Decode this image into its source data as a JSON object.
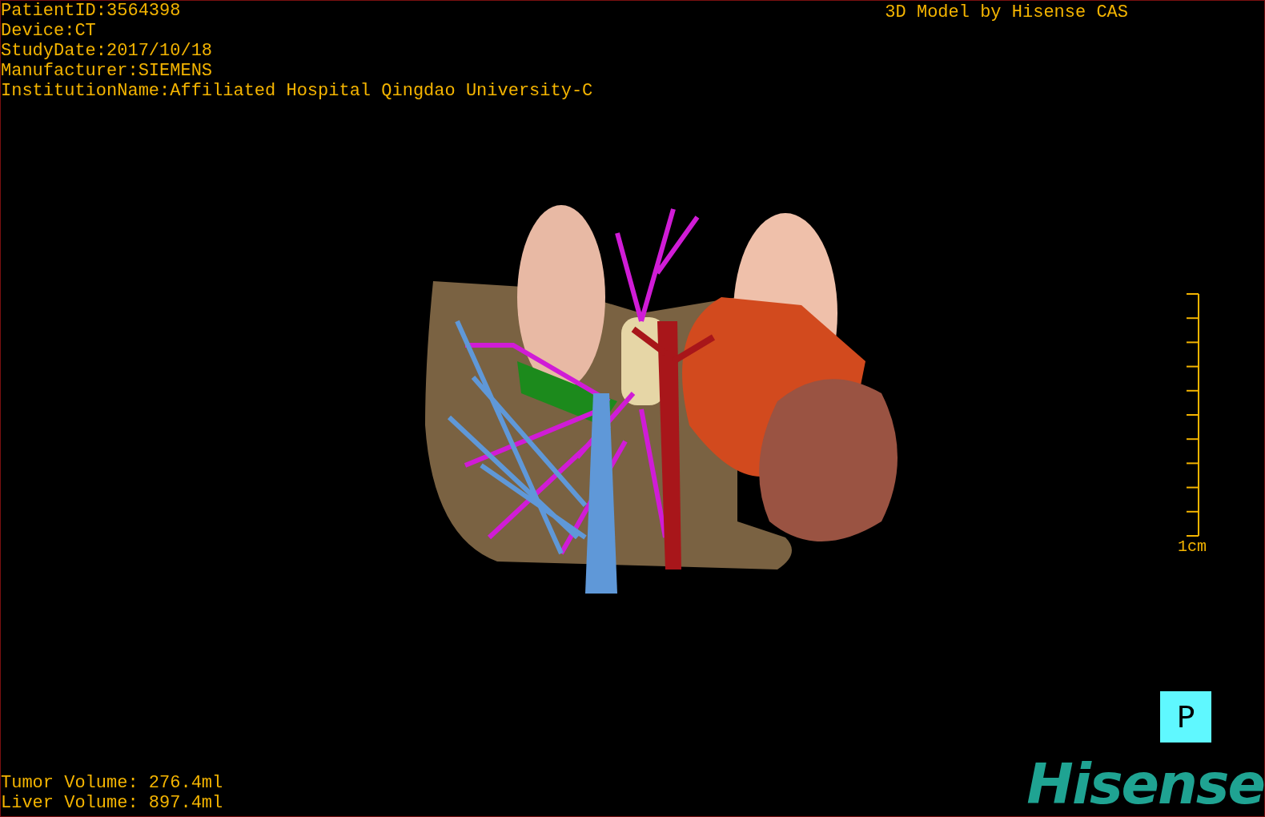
{
  "patient_info": [
    "PatientID:3564398",
    "Device:CT",
    "StudyDate:2017/10/18",
    "Manufacturer:SIEMENS",
    "InstitutionName:Affiliated Hospital Qingdao University-C"
  ],
  "title": "3D Model by Hisense CAS",
  "scale": {
    "label": "1cm"
  },
  "volumes": [
    "Tumor Volume: 276.4ml",
    "Liver Volume: 897.4ml"
  ],
  "orientation_button": "P",
  "logo": "Hisense"
}
